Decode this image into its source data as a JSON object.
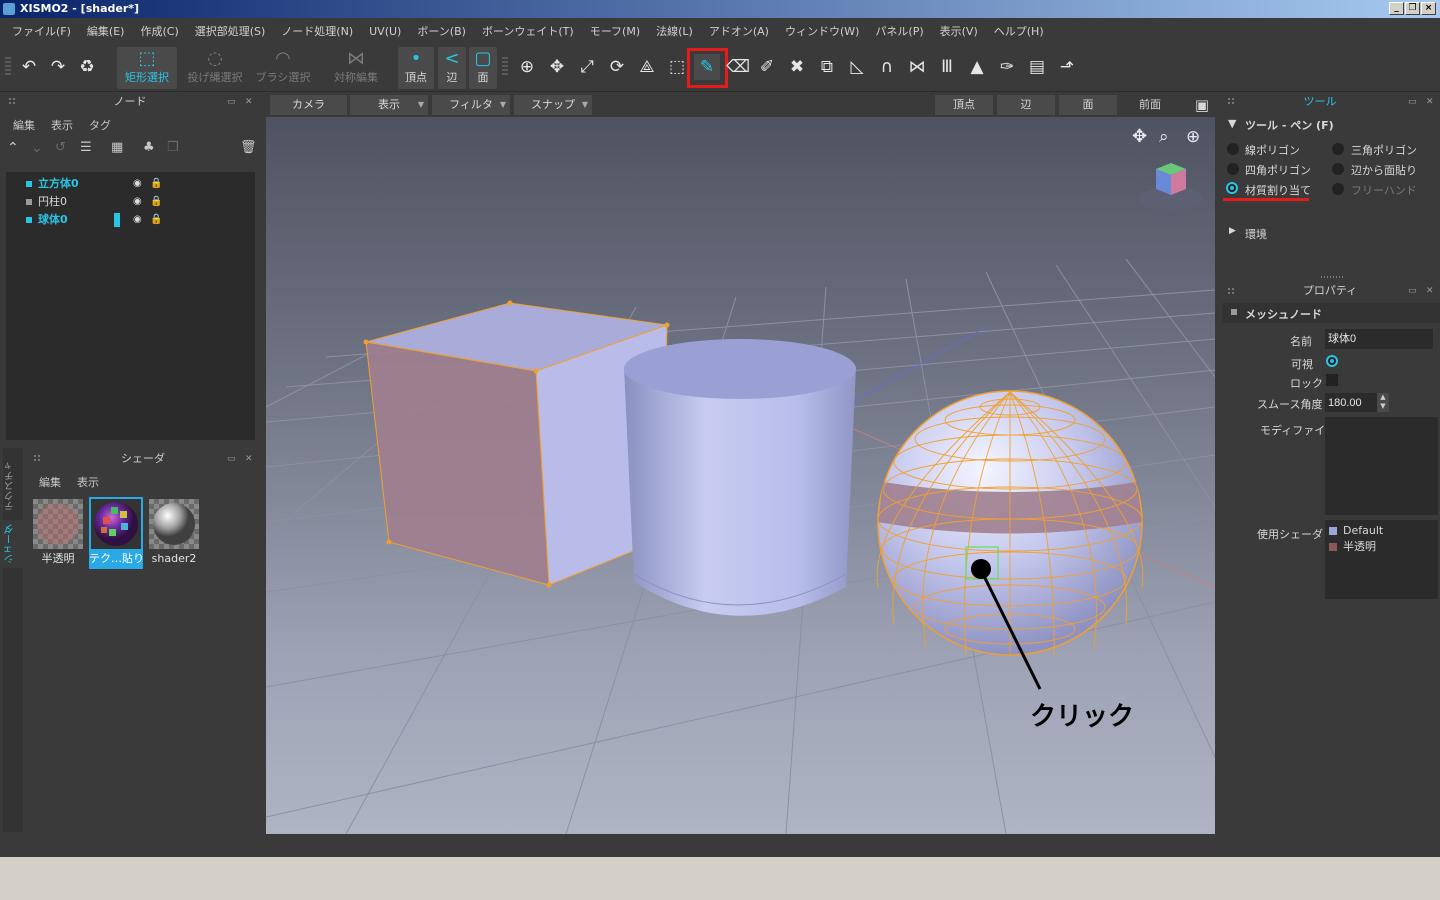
{
  "window": {
    "title": "XISMO2 - [shader*]"
  },
  "menu": [
    "ファイル(F)",
    "編集(E)",
    "作成(C)",
    "選択部処理(S)",
    "ノード処理(N)",
    "UV(U)",
    "ボーン(B)",
    "ボーンウェイト(T)",
    "モーフ(M)",
    "法線(L)",
    "アドオン(A)",
    "ウィンドウ(W)",
    "パネル(P)",
    "表示(V)",
    "ヘルプ(H)"
  ],
  "toolbar": {
    "rect_select": "矩形選択",
    "lasso_select": "投げ縄選択",
    "brush_select": "ブラシ選択",
    "symmetric_edit": "対称編集",
    "vertex": "頂点",
    "edge": "辺",
    "face": "面"
  },
  "node_panel": {
    "title": "ノード",
    "menu_edit": "編集",
    "menu_view": "表示",
    "menu_tag": "タグ",
    "nodes": [
      {
        "name": "立方体0",
        "selected": true
      },
      {
        "name": "円柱0",
        "selected": false
      },
      {
        "name": "球体0",
        "selected": true
      }
    ]
  },
  "shader_panel": {
    "title": "シェーダ",
    "menu_edit": "編集",
    "menu_view": "表示",
    "side_tab_texture": "テクスチャ",
    "side_tab_shader": "シェーダ",
    "shaders": [
      {
        "name": "半透明",
        "selected": false
      },
      {
        "name": "テク…貼り",
        "selected": true
      },
      {
        "name": "shader2",
        "selected": false
      }
    ]
  },
  "viewport": {
    "camera": "カメラ",
    "view": "表示",
    "filter": "フィルタ",
    "snap": "スナップ",
    "mode_vertex": "頂点",
    "mode_edge": "辺",
    "mode_face": "面",
    "view_front": "前面",
    "annotation": "クリック"
  },
  "tool_panel": {
    "title": "ツール",
    "section": "ツール - ペン (F)",
    "options": [
      {
        "label": "線ポリゴン",
        "selected": false,
        "enabled": true
      },
      {
        "label": "三角ポリゴン",
        "selected": false,
        "enabled": true
      },
      {
        "label": "四角ポリゴン",
        "selected": false,
        "enabled": true
      },
      {
        "label": "辺から面貼り",
        "selected": false,
        "enabled": true
      },
      {
        "label": "材質割り当て",
        "selected": true,
        "enabled": true
      },
      {
        "label": "フリーハンド",
        "selected": false,
        "enabled": false
      }
    ],
    "env_section": "環境"
  },
  "properties": {
    "title": "プロパティ",
    "section": "メッシュノード",
    "name_label": "名前",
    "name_value": "球体0",
    "visible_label": "可視",
    "visible": true,
    "lock_label": "ロック",
    "lock": false,
    "smooth_label": "スムース角度",
    "smooth_value": "180.00",
    "modifier_label": "モディファイア",
    "shader_label": "使用シェーダ",
    "shaders_used": [
      {
        "name": "Default",
        "color": "#9aa6d6"
      },
      {
        "name": "半透明",
        "color": "#8a5a5a"
      }
    ]
  },
  "colors": {
    "accent": "#29c5e6",
    "highlight": "#e21b1b",
    "mesh_select": "#f0a030"
  }
}
